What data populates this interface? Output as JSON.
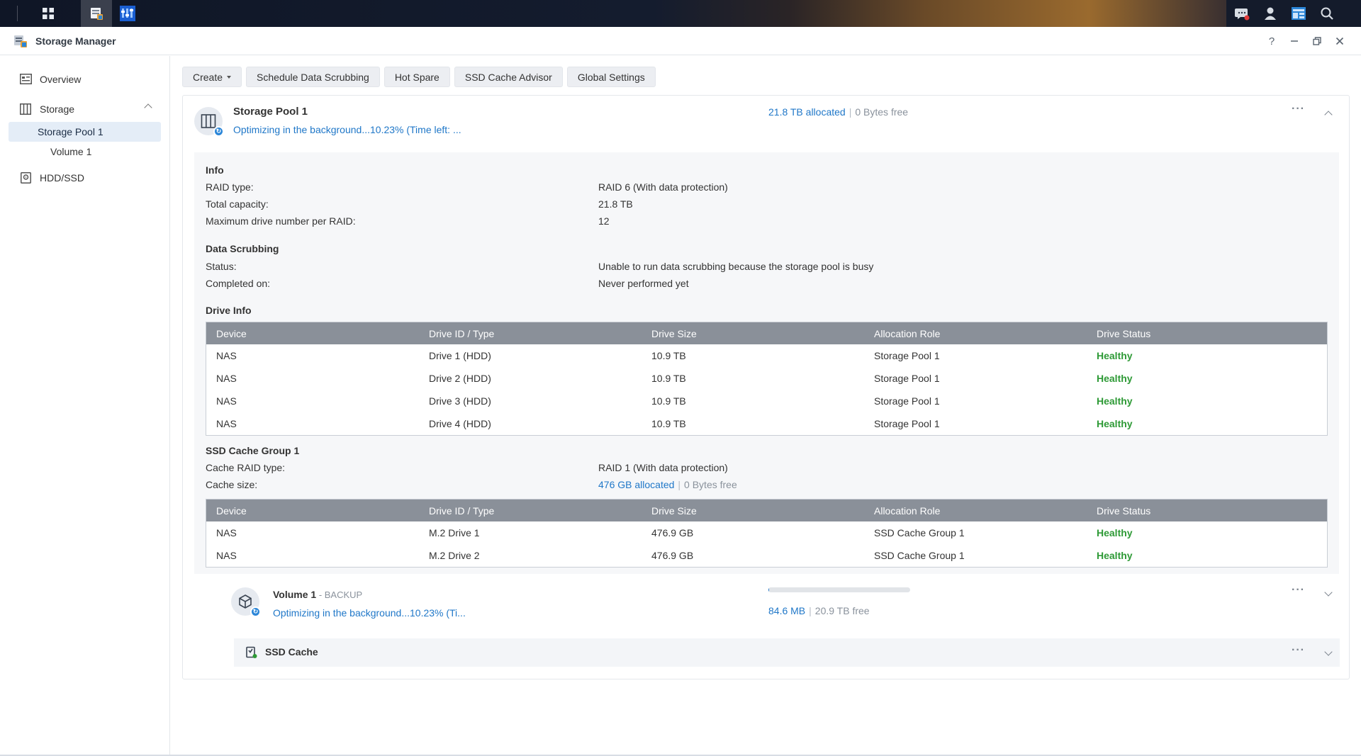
{
  "window": {
    "title": "Storage Manager",
    "help": "?"
  },
  "sidebar": {
    "overview": "Overview",
    "storage": "Storage",
    "storage_pool": "Storage Pool 1",
    "volume": "Volume 1",
    "hdd": "HDD/SSD"
  },
  "toolbar": {
    "create": "Create",
    "scrubbing": "Schedule Data Scrubbing",
    "hot_spare": "Hot Spare",
    "ssd_advisor": "SSD Cache Advisor",
    "global_settings": "Global Settings"
  },
  "pool": {
    "name": "Storage Pool 1",
    "status": "Optimizing in the background...10.23% (Time left: ...",
    "allocated": "21.8 TB allocated",
    "separator": "|",
    "free": "0 Bytes free",
    "more": "···"
  },
  "info": {
    "title": "Info",
    "raid_label": "RAID type:",
    "raid_value": "RAID 6 (With data protection)",
    "capacity_label": "Total capacity:",
    "capacity_value": "21.8 TB",
    "maxdrive_label": "Maximum drive number per RAID:",
    "maxdrive_value": "12"
  },
  "scrubbing": {
    "title": "Data Scrubbing",
    "status_label": "Status:",
    "status_value": "Unable to run data scrubbing because the storage pool is busy",
    "completed_label": "Completed on:",
    "completed_value": "Never performed yet"
  },
  "drive_info": {
    "title": "Drive Info",
    "headers": [
      "Device",
      "Drive ID / Type",
      "Drive Size",
      "Allocation Role",
      "Drive Status"
    ],
    "rows": [
      [
        "NAS",
        "Drive 1 (HDD)",
        "10.9 TB",
        "Storage Pool 1",
        "Healthy"
      ],
      [
        "NAS",
        "Drive 2 (HDD)",
        "10.9 TB",
        "Storage Pool 1",
        "Healthy"
      ],
      [
        "NAS",
        "Drive 3 (HDD)",
        "10.9 TB",
        "Storage Pool 1",
        "Healthy"
      ],
      [
        "NAS",
        "Drive 4 (HDD)",
        "10.9 TB",
        "Storage Pool 1",
        "Healthy"
      ]
    ]
  },
  "ssd_group": {
    "title": "SSD Cache Group 1",
    "raid_label": "Cache RAID type:",
    "raid_value": "RAID 1 (With data protection)",
    "size_label": "Cache size:",
    "size_allocated": "476 GB allocated",
    "size_free": "0 Bytes free",
    "headers": [
      "Device",
      "Drive ID / Type",
      "Drive Size",
      "Allocation Role",
      "Drive Status"
    ],
    "rows": [
      [
        "NAS",
        "M.2 Drive 1",
        "476.9 GB",
        "SSD Cache Group 1",
        "Healthy"
      ],
      [
        "NAS",
        "M.2 Drive 2",
        "476.9 GB",
        "SSD Cache Group 1",
        "Healthy"
      ]
    ]
  },
  "volume": {
    "name": "Volume 1",
    "dash": " - ",
    "tag": "BACKUP",
    "status": "Optimizing in the background...10.23% (Ti...",
    "used": "84.6 MB",
    "free": "20.9 TB free",
    "usage_fraction": 0.004
  },
  "ssd_cache": {
    "label": "SSD Cache"
  },
  "colors": {
    "accent": "#1f77c8",
    "healthy": "#2e9a36",
    "table_header": "#8a9099"
  }
}
